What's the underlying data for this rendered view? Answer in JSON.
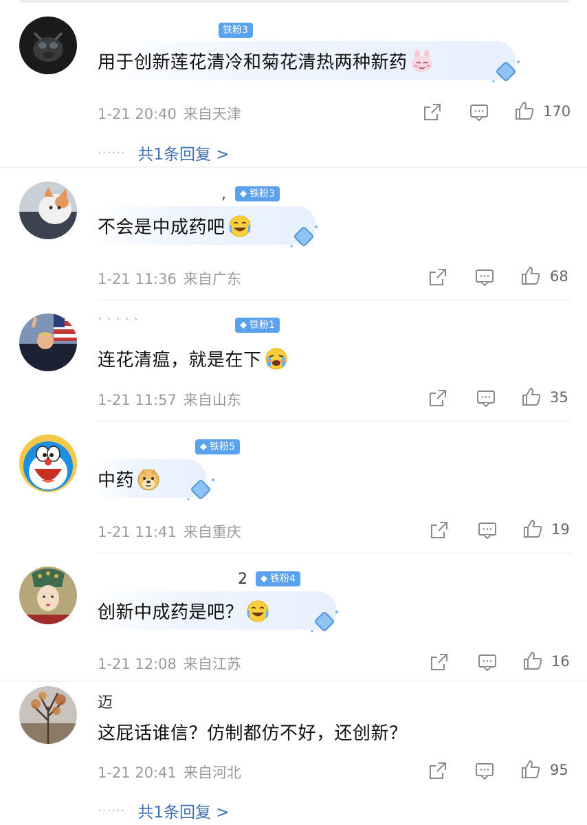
{
  "comments": [
    {
      "username": "",
      "badge": "铁粉3",
      "text": "用于创新莲花清冷和菊花清热两种新药",
      "time": "1-21 20:40",
      "location": "来自天津",
      "likes": "170",
      "replies": "共1条回复 >",
      "emoji": "rabbit-smile",
      "avatar": "dark-dog-photo"
    },
    {
      "username": "",
      "badge": "铁粉3",
      "text": "不会是中成药吧",
      "time": "1-21 11:36",
      "location": "来自广东",
      "likes": "68",
      "emoji": "laugh-cry",
      "avatar": "cat-photo"
    },
    {
      "username": "",
      "badge": "铁粉1",
      "text": "连花清瘟，就是在下",
      "time": "1-21 11:57",
      "location": "来自山东",
      "likes": "35",
      "emoji": "crying-blush",
      "avatar": "crowd-flag-photo"
    },
    {
      "username": "",
      "badge": "铁粉5",
      "text": "中药",
      "time": "1-21 11:41",
      "location": "来自重庆",
      "likes": "19",
      "emoji": "doge",
      "avatar": "doraemon"
    },
    {
      "username": "2",
      "badge": "铁粉4",
      "text": "创新中成药是吧？",
      "time": "1-21 12:08",
      "location": "来自江苏",
      "likes": "16",
      "emoji": "laugh-cry",
      "avatar": "painted-portrait"
    },
    {
      "username": "迈",
      "badge": "",
      "text": "这屁话谁信？仿制都仿不好，还创新？",
      "time": "1-21 20:41",
      "location": "来自河北",
      "likes": "95",
      "replies": "共1条回复 >",
      "avatar": "autumn-tree-photo"
    }
  ],
  "icons": {
    "share": "share-icon",
    "comment": "comment-icon",
    "like": "thumbs-up-icon"
  },
  "colors": {
    "badge": "#5aa2ee",
    "link": "#3f6fb0",
    "meta": "#9a9a9a"
  }
}
